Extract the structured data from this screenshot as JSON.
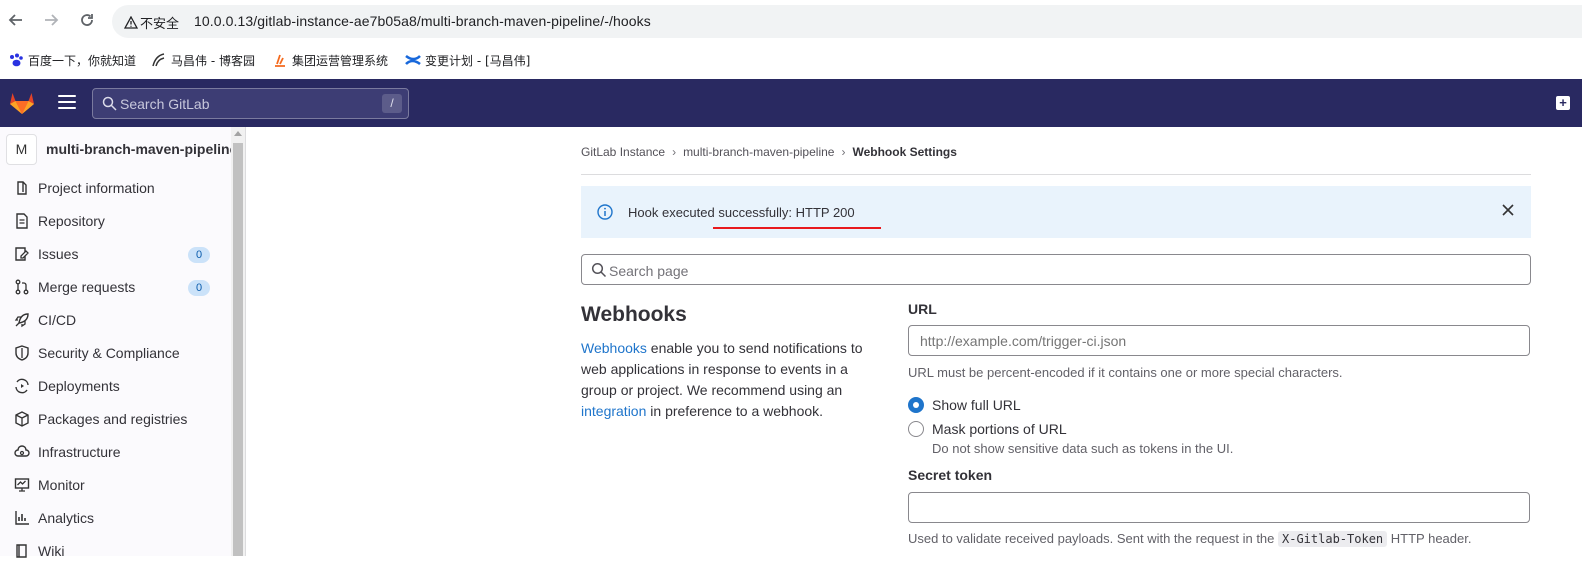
{
  "browser": {
    "security_label": "不安全",
    "url": "10.0.0.13/gitlab-instance-ae7b05a8/multi-branch-maven-pipeline/-/hooks",
    "bookmarks": [
      {
        "label": "百度一下，你就知道",
        "icon": "baidu-paw-icon",
        "color": "#2932e1"
      },
      {
        "label": "马昌伟 - 博客园",
        "icon": "cnblogs-icon",
        "color": "#333333"
      },
      {
        "label": "集团运营管理系统",
        "icon": "flame-icon",
        "color": "#f46a1e"
      },
      {
        "label": "变更计划 - [马昌伟]",
        "icon": "confluence-icon",
        "color": "#1868db"
      }
    ]
  },
  "topbar": {
    "search_placeholder": "Search GitLab",
    "search_shortcut": "/",
    "bg_color": "#292961"
  },
  "sidebar": {
    "project_avatar": "M",
    "project_name": "multi-branch-maven-pipeline",
    "items": [
      {
        "label": "Project information",
        "icon": "project-info-icon"
      },
      {
        "label": "Repository",
        "icon": "repository-icon"
      },
      {
        "label": "Issues",
        "icon": "issues-icon",
        "badge": "0"
      },
      {
        "label": "Merge requests",
        "icon": "merge-request-icon",
        "badge": "0"
      },
      {
        "label": "CI/CD",
        "icon": "rocket-icon"
      },
      {
        "label": "Security & Compliance",
        "icon": "shield-icon"
      },
      {
        "label": "Deployments",
        "icon": "deployments-icon"
      },
      {
        "label": "Packages and registries",
        "icon": "package-icon"
      },
      {
        "label": "Infrastructure",
        "icon": "cloud-icon"
      },
      {
        "label": "Monitor",
        "icon": "monitor-icon"
      },
      {
        "label": "Analytics",
        "icon": "chart-icon"
      },
      {
        "label": "Wiki",
        "icon": "book-icon"
      }
    ]
  },
  "breadcrumb": {
    "items": [
      "GitLab Instance",
      "multi-branch-maven-pipeline",
      "Webhook Settings"
    ]
  },
  "alert": {
    "text": "Hook executed successfully: HTTP 200",
    "accent": "#e9f3fc",
    "underline_color": "#e8191d"
  },
  "page_search": {
    "placeholder": "Search page"
  },
  "webhooks": {
    "title": "Webhooks",
    "desc_link1": "Webhooks",
    "desc_part1": " enable you to send notifications to web applications in response to events in a group or project. We recommend using an ",
    "desc_link2": "integration",
    "desc_part2": " in preference to a webhook."
  },
  "form": {
    "url_label": "URL",
    "url_placeholder": "http://example.com/trigger-ci.json",
    "url_help": "URL must be percent-encoded if it contains one or more special characters.",
    "radio_show": "Show full URL",
    "radio_mask": "Mask portions of URL",
    "mask_help": "Do not show sensitive data such as tokens in the UI.",
    "secret_label": "Secret token",
    "secret_help_pre": "Used to validate received payloads. Sent with the request in the ",
    "secret_help_code": "X-Gitlab-Token",
    "secret_help_post": " HTTP header."
  }
}
